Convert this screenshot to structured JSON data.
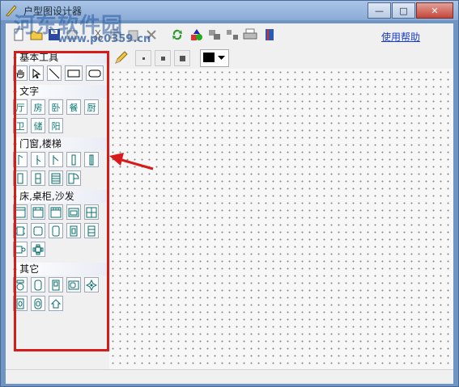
{
  "window": {
    "title": "户型图设计器",
    "buttons": {
      "minimize": "—",
      "maximize": "□",
      "close": "✕"
    }
  },
  "watermark": {
    "text": "河东软件园",
    "url": "www.pc0359.cn"
  },
  "toolbar": {
    "help_label": "使用帮助",
    "icons": [
      "new-icon",
      "open-icon",
      "save-icon",
      "print-preview-icon",
      "cut-icon",
      "copy-icon",
      "paste-icon",
      "delete-icon",
      "refresh-icon",
      "shapes-icon",
      "group-icon",
      "ungroup-icon",
      "printer-icon",
      "book-icon"
    ]
  },
  "drawtools": {
    "pen": "pencil-icon",
    "sizes": [
      "small-dot",
      "medium-dot",
      "large-dot"
    ],
    "color": "#000000"
  },
  "palette": {
    "sections": [
      {
        "title": "基本工具",
        "tools": [
          "hand-icon",
          "pointer-icon",
          "line-icon",
          "rectangle-icon",
          "rounded-rectangle-icon"
        ]
      },
      {
        "title": "文字",
        "tools": [
          "厅",
          "房",
          "卧",
          "餐",
          "厨",
          "卫",
          "储",
          "阳"
        ]
      },
      {
        "title": "门窗,楼梯",
        "tools": [
          "door-1",
          "door-2",
          "door-3",
          "window-1",
          "window-2",
          "window-3",
          "window-4",
          "stair-1",
          "door-4"
        ]
      },
      {
        "title": "床,桌柜,沙发",
        "tools": [
          "bed-1",
          "bed-2",
          "bed-3",
          "sofa-1",
          "cabinet-1",
          "table-1",
          "table-2",
          "bed-4",
          "cabinet-2",
          "cabinet-3",
          "chair-1",
          "dining-set"
        ]
      },
      {
        "title": "其它",
        "tools": [
          "toilet-icon",
          "bathtub-icon",
          "fridge-icon",
          "sink-icon",
          "plant-icon",
          "washbasin-icon",
          "shower-icon",
          "home-icon"
        ]
      }
    ]
  }
}
